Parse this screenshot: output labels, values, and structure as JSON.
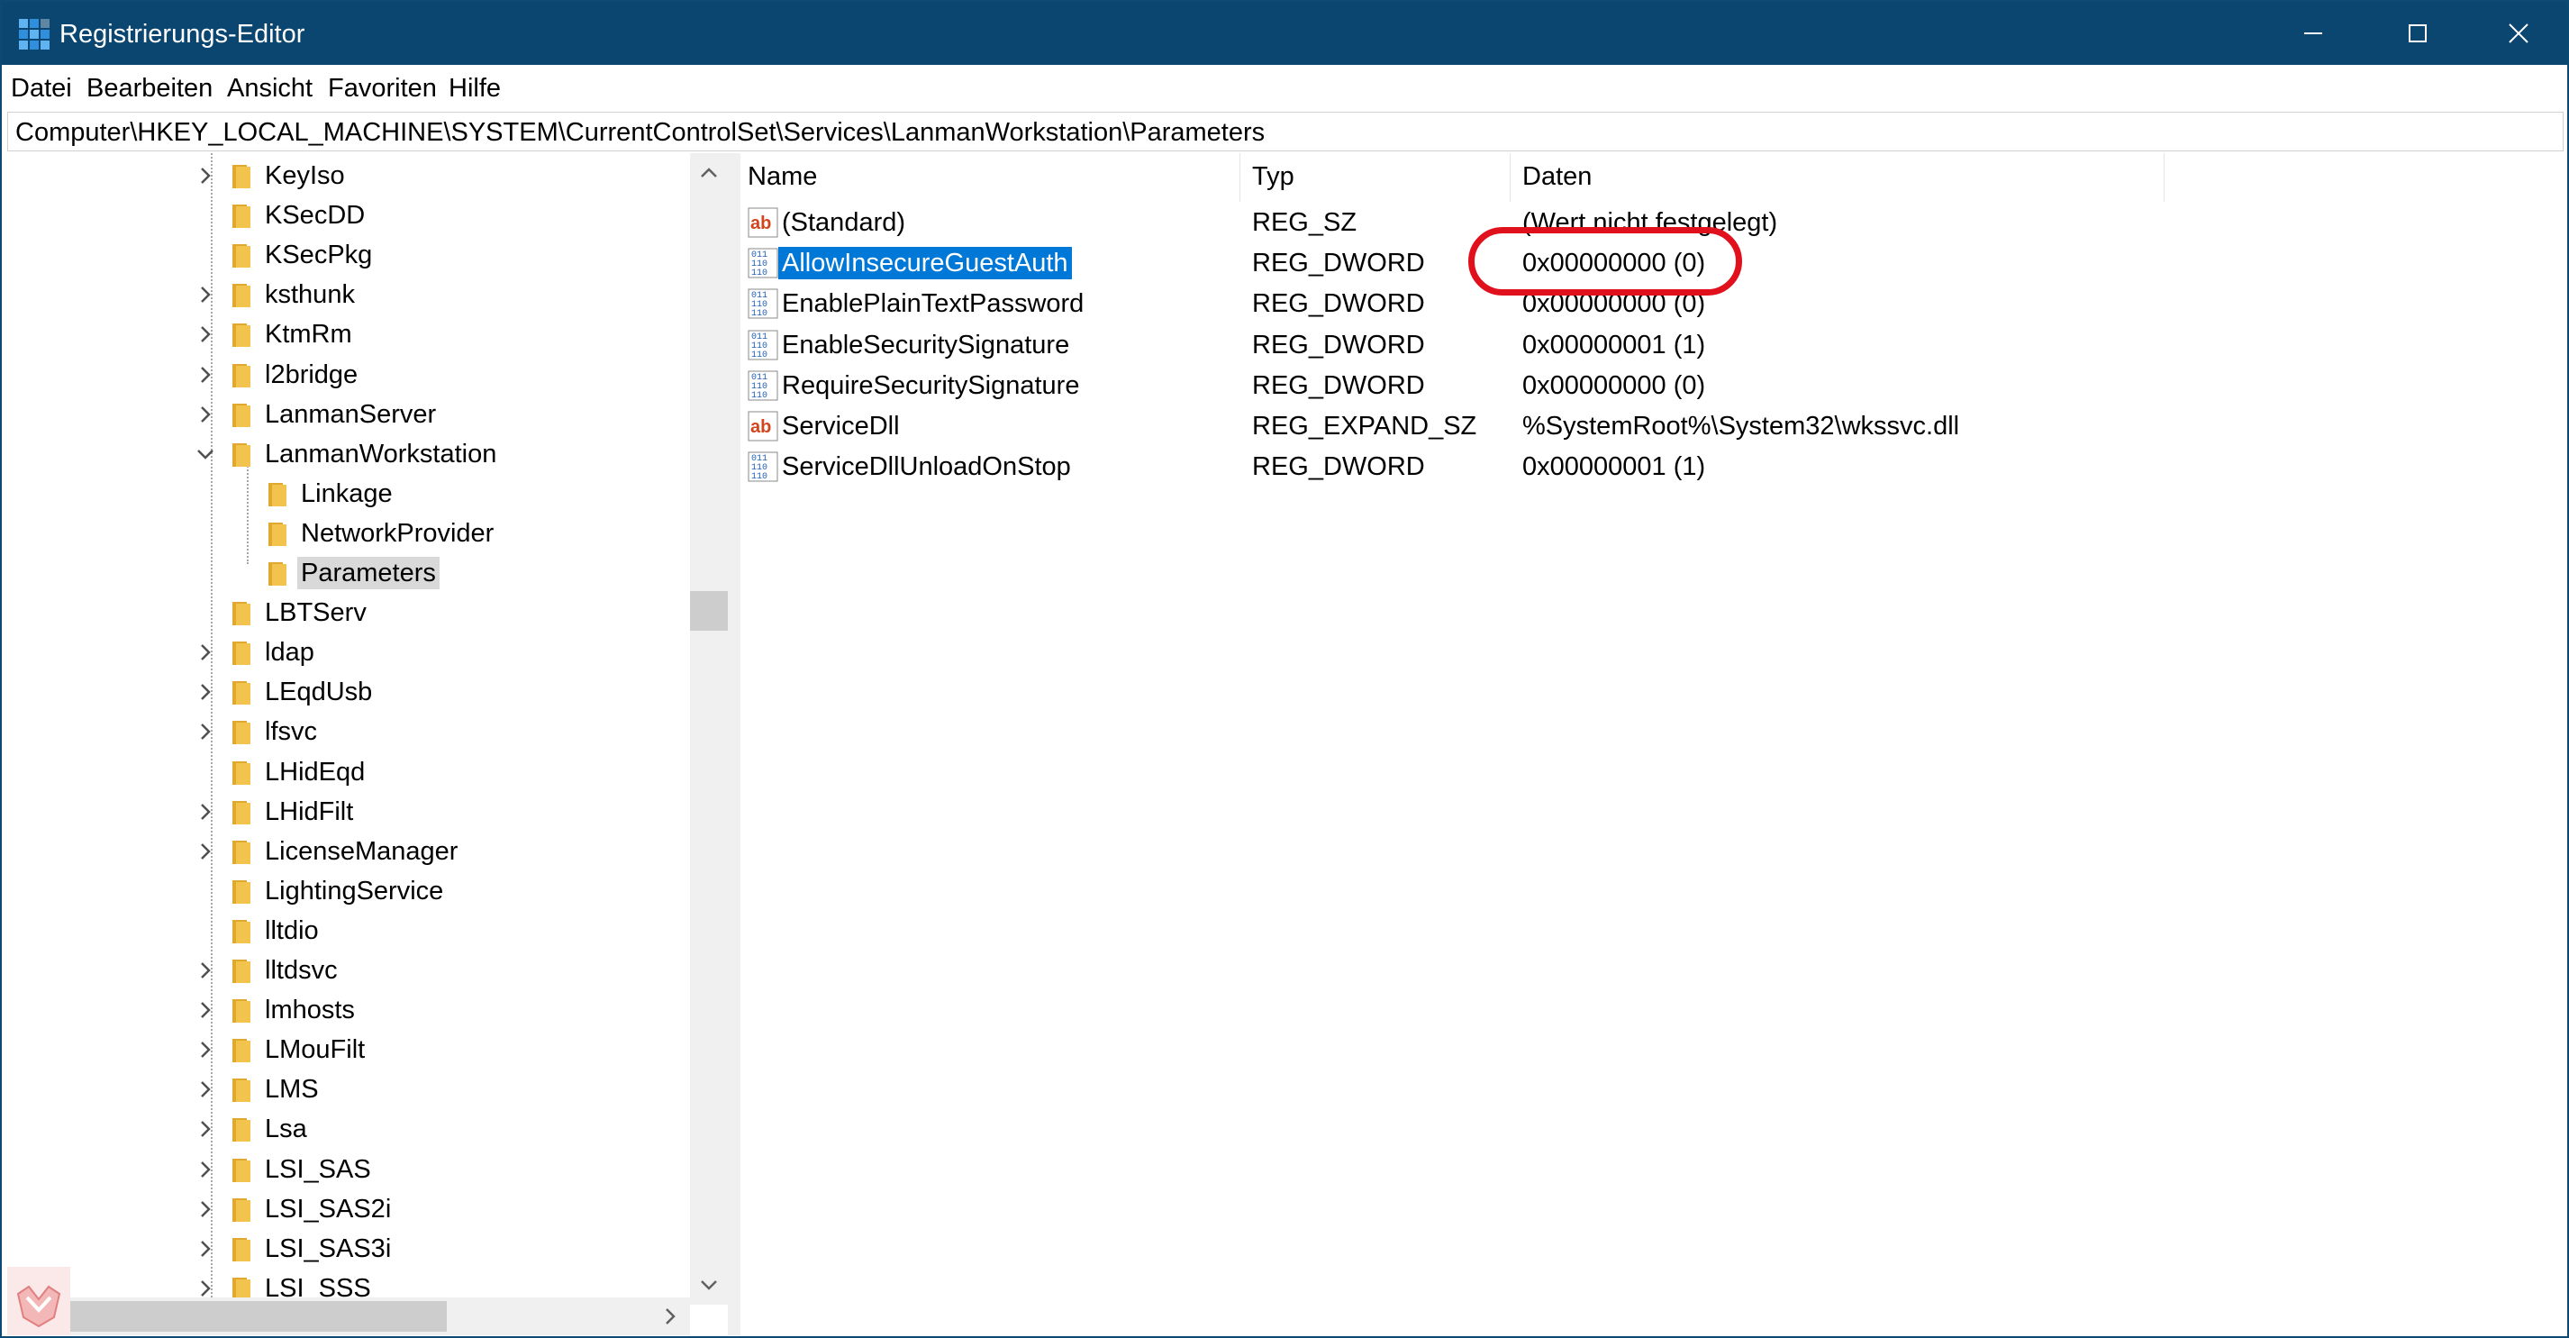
{
  "window": {
    "title": "Registrierungs-Editor",
    "title_bar_color": "#0a4670"
  },
  "menu": {
    "items": [
      "Datei",
      "Bearbeiten",
      "Ansicht",
      "Favoriten",
      "Hilfe"
    ]
  },
  "address": {
    "path": "Computer\\HKEY_LOCAL_MACHINE\\SYSTEM\\CurrentControlSet\\Services\\LanmanWorkstation\\Parameters"
  },
  "tree": {
    "items": [
      {
        "label": "KeyIso",
        "expander": "collapsed"
      },
      {
        "label": "KSecDD",
        "expander": "none"
      },
      {
        "label": "KSecPkg",
        "expander": "none"
      },
      {
        "label": "ksthunk",
        "expander": "collapsed"
      },
      {
        "label": "KtmRm",
        "expander": "collapsed"
      },
      {
        "label": "l2bridge",
        "expander": "collapsed"
      },
      {
        "label": "LanmanServer",
        "expander": "collapsed"
      },
      {
        "label": "LanmanWorkstation",
        "expander": "expanded"
      },
      {
        "label": "Linkage",
        "expander": "none"
      },
      {
        "label": "NetworkProvider",
        "expander": "none"
      },
      {
        "label": "Parameters",
        "expander": "none",
        "selected": true
      },
      {
        "label": "LBTServ",
        "expander": "none"
      },
      {
        "label": "ldap",
        "expander": "collapsed"
      },
      {
        "label": "LEqdUsb",
        "expander": "collapsed"
      },
      {
        "label": "lfsvc",
        "expander": "collapsed"
      },
      {
        "label": "LHidEqd",
        "expander": "none"
      },
      {
        "label": "LHidFilt",
        "expander": "collapsed"
      },
      {
        "label": "LicenseManager",
        "expander": "collapsed"
      },
      {
        "label": "LightingService",
        "expander": "none"
      },
      {
        "label": "lltdio",
        "expander": "none"
      },
      {
        "label": "lltdsvc",
        "expander": "collapsed"
      },
      {
        "label": "lmhosts",
        "expander": "collapsed"
      },
      {
        "label": "LMouFilt",
        "expander": "collapsed"
      },
      {
        "label": "LMS",
        "expander": "collapsed"
      },
      {
        "label": "Lsa",
        "expander": "collapsed"
      },
      {
        "label": "LSI_SAS",
        "expander": "collapsed"
      },
      {
        "label": "LSI_SAS2i",
        "expander": "collapsed"
      },
      {
        "label": "LSI_SAS3i",
        "expander": "collapsed"
      },
      {
        "label": "LSI_SSS",
        "expander": "collapsed"
      }
    ]
  },
  "list": {
    "columns": [
      "Name",
      "Typ",
      "Daten"
    ],
    "rows": [
      {
        "name": "(Standard)",
        "type": "REG_SZ",
        "data": "(Wert nicht festgelegt)",
        "icon": "string-value-icon"
      },
      {
        "name": "AllowInsecureGuestAuth",
        "type": "REG_DWORD",
        "data": "0x00000000 (0)",
        "icon": "dword-value-icon",
        "selected": true
      },
      {
        "name": "EnablePlainTextPassword",
        "type": "REG_DWORD",
        "data": "0x00000000 (0)",
        "icon": "dword-value-icon"
      },
      {
        "name": "EnableSecuritySignature",
        "type": "REG_DWORD",
        "data": "0x00000001 (1)",
        "icon": "dword-value-icon"
      },
      {
        "name": "RequireSecuritySignature",
        "type": "REG_DWORD",
        "data": "0x00000000 (0)",
        "icon": "dword-value-icon"
      },
      {
        "name": "ServiceDll",
        "type": "REG_EXPAND_SZ",
        "data": "%SystemRoot%\\System32\\wkssvc.dll",
        "icon": "string-value-icon"
      },
      {
        "name": "ServiceDllUnloadOnStop",
        "type": "REG_DWORD",
        "data": "0x00000001 (1)",
        "icon": "dword-value-icon"
      }
    ]
  },
  "colors": {
    "selection": "#0078d7",
    "tree_selection": "#d9d9d9",
    "highlight_ring": "#e0101c",
    "folder": "#f2c44e"
  }
}
